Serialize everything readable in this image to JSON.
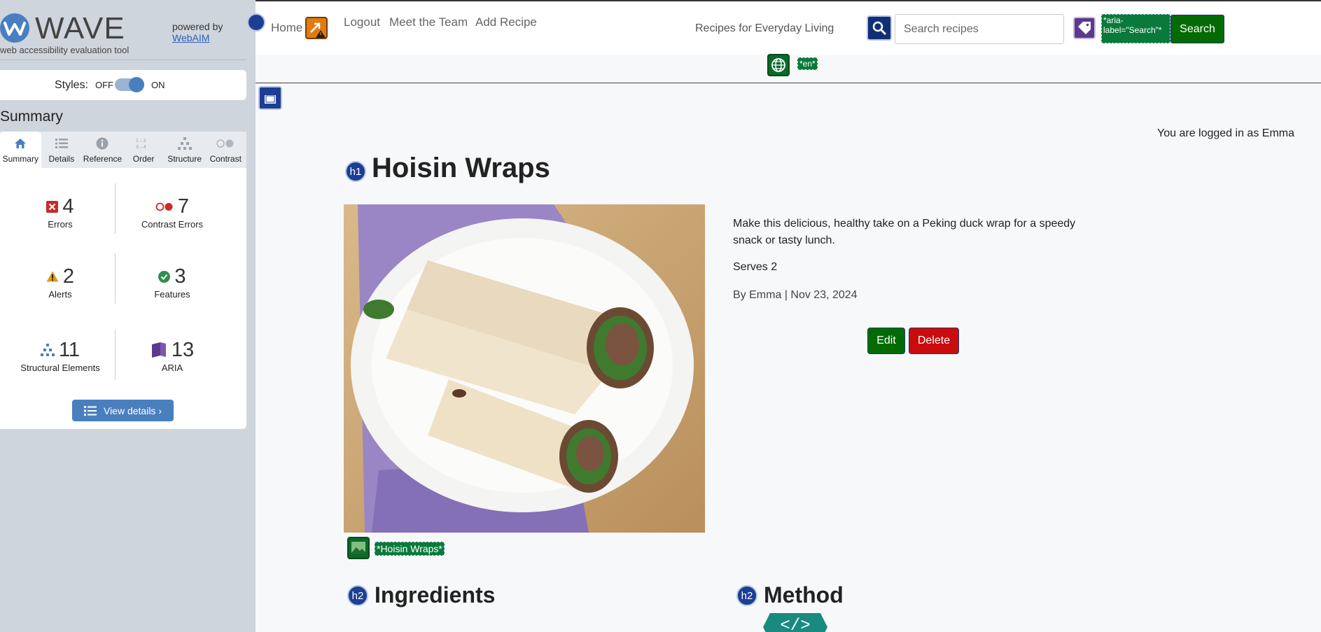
{
  "wave": {
    "logo_word": "WAVE",
    "logo_sub": "web accessibility evaluation tool",
    "powered_by": "powered by",
    "webaim": "WebAIM",
    "styles_label": "Styles:",
    "styles_off": "OFF",
    "styles_on": "ON",
    "section_title": "Summary",
    "tabs": [
      {
        "label": "Summary",
        "icon": "home-icon"
      },
      {
        "label": "Details",
        "icon": "list-icon"
      },
      {
        "label": "Reference",
        "icon": "info-icon"
      },
      {
        "label": "Order",
        "icon": "order-icon"
      },
      {
        "label": "Structure",
        "icon": "structure-icon"
      },
      {
        "label": "Contrast",
        "icon": "contrast-icon"
      }
    ],
    "stats": {
      "errors": {
        "value": "4",
        "label": "Errors"
      },
      "contrast_errors": {
        "value": "7",
        "label": "Contrast Errors"
      },
      "alerts": {
        "value": "2",
        "label": "Alerts"
      },
      "features": {
        "value": "3",
        "label": "Features"
      },
      "structural": {
        "value": "11",
        "label": "Structural Elements"
      },
      "aria": {
        "value": "13",
        "label": "ARIA"
      }
    },
    "view_details": "View details ›",
    "colors": {
      "accent": "#4a7fbf",
      "error": "#c92a2a",
      "alert": "#e09b15",
      "feature": "#2f8f4e",
      "aria": "#5b3a8c"
    }
  },
  "nav": {
    "home": "Home",
    "logout": "Logout",
    "team": "Meet the Team",
    "add": "Add Recipe",
    "brand": "Recipes for Everyday Living",
    "search_placeholder": "Search recipes",
    "aria_tag": "*aria-label=\"Search\"*",
    "search_btn": "Search",
    "lang_tag": "*en*"
  },
  "recipe": {
    "logged_in": "You are logged in as Emma",
    "h1_badge": "h1",
    "title": "Hoisin Wraps",
    "alt_tag": "*Hoisin Wraps*",
    "description": "Make this delicious, healthy take on a Peking duck wrap for a speedy snack or tasty lunch.",
    "serves": "Serves 2",
    "byline": "By Emma | Nov 23, 2024",
    "edit": "Edit",
    "delete": "Delete",
    "h2_badge": "h2",
    "ingredients": "Ingredients",
    "method": "Method"
  },
  "colors": {
    "green_button": "#046b04",
    "red_button": "#c90d0d",
    "heading_badge": "#1c3f94",
    "wave_tag": "#0a7a3a"
  }
}
